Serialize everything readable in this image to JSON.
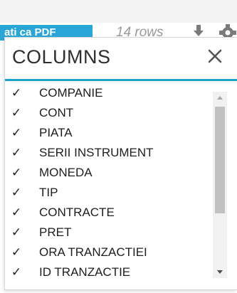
{
  "toolbar": {
    "export_pdf_label": "ati ca PDF",
    "row_count": "14 rows"
  },
  "popup": {
    "title": "COLUMNS",
    "close_symbol": "×",
    "check_symbol": "✓"
  },
  "columns": [
    {
      "label": "COMPANIE",
      "checked": true
    },
    {
      "label": "CONT",
      "checked": true
    },
    {
      "label": "PIATA",
      "checked": true
    },
    {
      "label": "SERII INSTRUMENT",
      "checked": true
    },
    {
      "label": "MONEDA",
      "checked": true
    },
    {
      "label": "TIP",
      "checked": true
    },
    {
      "label": "CONTRACTE",
      "checked": true
    },
    {
      "label": "PRET",
      "checked": true
    },
    {
      "label": "ORA TRANZACTIEI",
      "checked": true
    },
    {
      "label": "ID TRANZACTIE",
      "checked": true
    }
  ],
  "colors": {
    "accent": "#1aa3cf",
    "button": "#2aa6d6"
  },
  "icons": {
    "download": "download-icon",
    "settings": "gear-icon",
    "close": "close-icon",
    "scroll_up": "arrow-up-icon",
    "scroll_down": "arrow-down-icon"
  }
}
